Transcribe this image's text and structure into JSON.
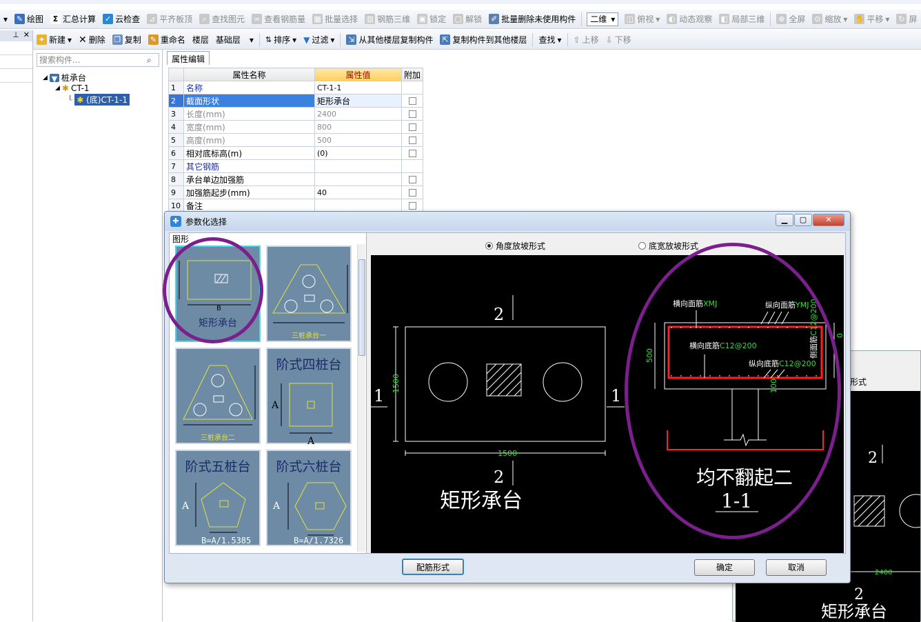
{
  "toolbar1": {
    "items": [
      "绘图",
      "汇总计算",
      "云检查",
      "平齐板顶",
      "查找图元",
      "查看钢筋量",
      "批量选择",
      "钢筋三维",
      "锁定",
      "解锁",
      "批量删除未使用构件"
    ],
    "view_mode": "二维",
    "items2": [
      "俯视",
      "动态观察",
      "局部三维",
      "全屏",
      "缩放",
      "平移",
      "屏"
    ]
  },
  "toolbar2": {
    "items": [
      "新建",
      "删除",
      "复制",
      "重命名",
      "楼层"
    ],
    "floor": "基础层",
    "items2": [
      "排序",
      "过滤",
      "从其他楼层复制构件",
      "复制构件到其他楼层",
      "查找",
      "上移",
      "下移"
    ]
  },
  "tree": {
    "search_placeholder": "搜索构件...",
    "root": "桩承台",
    "child": "CT-1",
    "leaf": "(底)CT-1-1"
  },
  "props": {
    "tab": "属性编辑",
    "headers": {
      "name": "属性名称",
      "value": "属性值",
      "extra": "附加"
    },
    "rows": [
      {
        "n": "1",
        "name": "名称",
        "value": ""
      },
      {
        "n": "2",
        "name": "截面形状",
        "value": "矩形承台"
      },
      {
        "n": "3",
        "name": "长度(mm)",
        "value": "2400"
      },
      {
        "n": "4",
        "name": "宽度(mm)",
        "value": "800"
      },
      {
        "n": "5",
        "name": "高度(mm)",
        "value": "500"
      },
      {
        "n": "6",
        "name": "相对底标高(m)",
        "value": "(0)"
      },
      {
        "n": "7",
        "name": "其它钢筋",
        "value": ""
      },
      {
        "n": "8",
        "name": "承台单边加强筋",
        "value": ""
      },
      {
        "n": "9",
        "name": "加强筋起步(mm)",
        "value": "40"
      },
      {
        "n": "10",
        "name": "备注",
        "value": ""
      }
    ],
    "row1_value": "CT-1-1"
  },
  "dialog": {
    "title": "参数化选择",
    "group_label": "图形",
    "shapes": [
      {
        "caption": "矩形承台",
        "dim": "B"
      },
      {
        "caption": "三桩承台一"
      },
      {
        "caption": "三桩承台二"
      },
      {
        "caption": "阶式四桩台",
        "dim": "A"
      },
      {
        "caption": "阶式五桩台",
        "dim": "A",
        "formula": "B=A/1.5385"
      },
      {
        "caption": "阶式六桩台",
        "dim": "A",
        "formula": "B=A/1.7326"
      }
    ],
    "radio1": "角度放坡形式",
    "radio2": "底宽放坡形式",
    "cad": {
      "plan_label": "矩形承台",
      "section_mark": "2",
      "side_mark": "1",
      "dim_w": "1500",
      "dim_h": "1500",
      "sec_h": "500",
      "label_top_trans": "横向面筋",
      "code_top_trans": "XMJ",
      "label_top_long": "纵向面筋",
      "code_top_long": "YMJ",
      "label_bot_trans": "横向底筋",
      "code_bot_trans": "C12@200",
      "label_bot_long": "纵向底筋",
      "code_bot_long": "C12@200",
      "label_side": "侧面筋",
      "code_side": "C12@200",
      "dim_side": "100",
      "dim_right": "0",
      "section_title": "均不翻起二",
      "section_name": "1-1"
    },
    "btn_rebar": "配筋形式",
    "btn_ok": "确定",
    "btn_cancel": "取消"
  },
  "bgwin": {
    "radio": "形式",
    "section_mark": "2",
    "dim": "2400",
    "label": "矩形承台"
  },
  "colors": {
    "annotation": "#7b1f8c",
    "cad_green": "#2fe02f",
    "cad_red": "#ff2020",
    "thumb_bg": "#6e8ba5"
  }
}
